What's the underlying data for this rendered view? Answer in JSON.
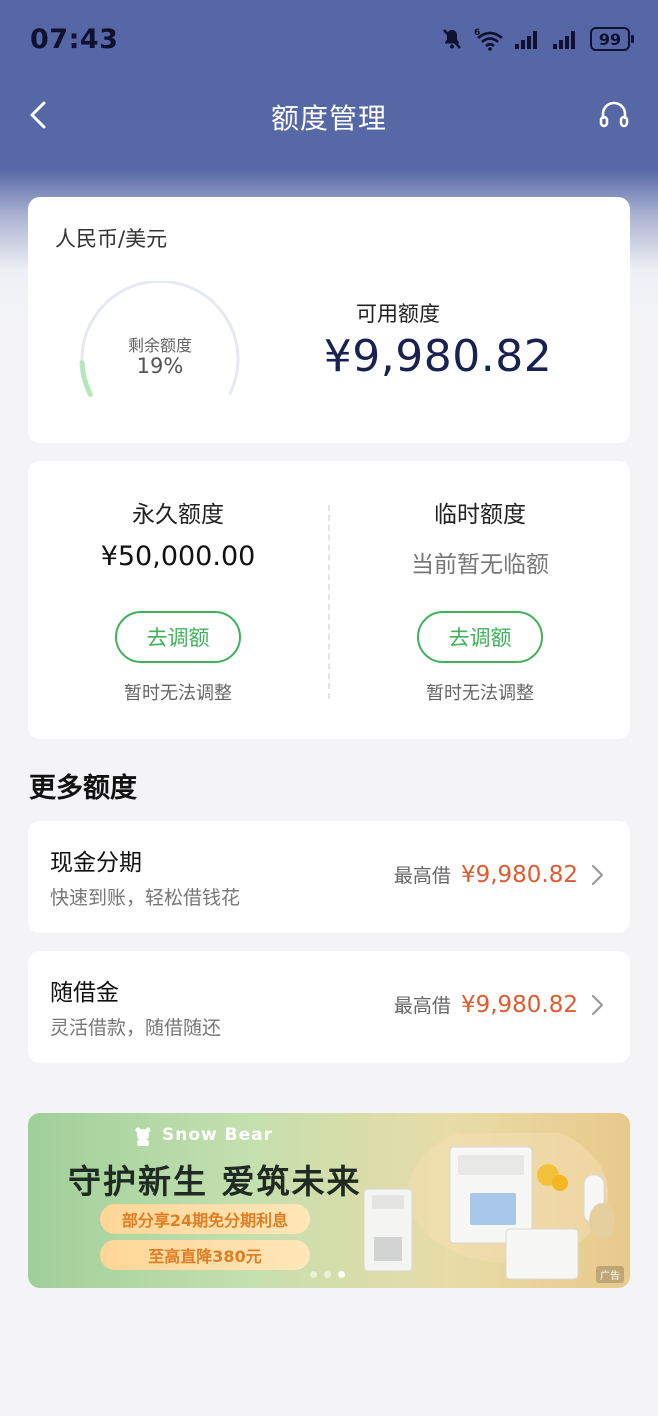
{
  "status": {
    "time": "07:43",
    "battery": "99"
  },
  "nav": {
    "title": "额度管理"
  },
  "quota": {
    "currency": "人民币/美元",
    "gauge_label": "剩余额度",
    "gauge_percent": "19%",
    "remaining_fraction": 0.19,
    "available_label": "可用额度",
    "available_amount": "¥9,980.82"
  },
  "limits": {
    "permanent": {
      "title": "永久额度",
      "value": "¥50,000.00",
      "button": "去调额",
      "note": "暂时无法调整"
    },
    "temporary": {
      "title": "临时额度",
      "value": "当前暂无临额",
      "button": "去调额",
      "note": "暂时无法调整"
    }
  },
  "more": {
    "title": "更多额度",
    "items": [
      {
        "name": "现金分期",
        "desc": "快速到账，轻松借钱花",
        "max_label": "最高借",
        "max_value": "¥9,980.82"
      },
      {
        "name": "随借金",
        "desc": "灵活借款，随借随还",
        "max_label": "最高借",
        "max_value": "¥9,980.82"
      }
    ]
  },
  "banner": {
    "brand": "Snow Bear",
    "slogan": "守护新生 爱筑未来",
    "pill1": "部分享24期免分期利息",
    "pill2": "至高直降380元",
    "ad_tag": "广告",
    "dots_total": 3,
    "active_dot": 3
  },
  "colors": {
    "nav_bg": "#5768a7",
    "accent_green": "#3fb25a",
    "amount_orange": "#e2592d",
    "amount_navy": "#1a2150"
  },
  "icons": [
    "mute-icon",
    "wifi-icon",
    "signal-icon",
    "battery-icon",
    "back-arrow-icon",
    "headset-icon",
    "chevron-right-icon",
    "snow-bear-logo-icon"
  ]
}
